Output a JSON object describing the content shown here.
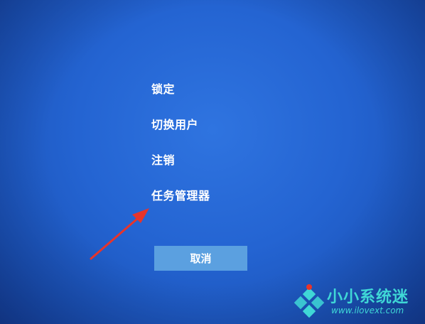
{
  "menu": {
    "items": [
      {
        "label": "锁定"
      },
      {
        "label": "切换用户"
      },
      {
        "label": "注销"
      },
      {
        "label": "任务管理器"
      }
    ]
  },
  "cancel_button": {
    "label": "取消"
  },
  "watermark": {
    "title": "小小系统迷",
    "url": "www.ilovext.com"
  },
  "colors": {
    "background": "#2464d2",
    "button": "#5ba0e0",
    "annotation_arrow": "#e8342a",
    "watermark": "#3fd7d6"
  }
}
